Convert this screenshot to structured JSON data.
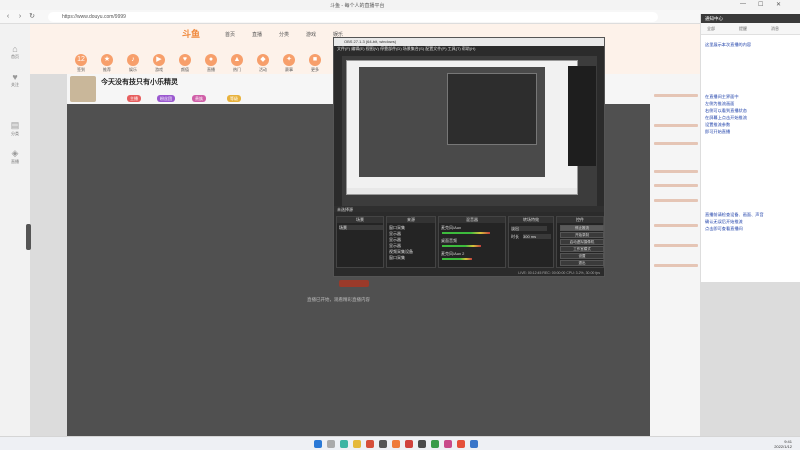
{
  "window": {
    "title": "斗鱼 - 每个人的直播平台"
  },
  "browser": {
    "url": "https://www.douyu.com/9999",
    "minimize": "—",
    "maximize": "☐",
    "close": "✕"
  },
  "sidebar": {
    "items": [
      {
        "icon": "⌂",
        "label": "首页"
      },
      {
        "icon": "♥",
        "label": "关注"
      },
      {
        "icon": "▤",
        "label": "分类"
      },
      {
        "icon": "◈",
        "label": "直播"
      }
    ]
  },
  "site": {
    "logo": "斗鱼",
    "nav": [
      "首页",
      "直播",
      "分类",
      "游戏",
      "娱乐"
    ],
    "categories": [
      {
        "icon": "12",
        "label": "签到"
      },
      {
        "icon": "★",
        "label": "推荐"
      },
      {
        "icon": "♪",
        "label": "娱乐"
      },
      {
        "icon": "▶",
        "label": "游戏"
      },
      {
        "icon": "♥",
        "label": "颜值"
      },
      {
        "icon": "●",
        "label": "直播"
      },
      {
        "icon": "▲",
        "label": "热门"
      },
      {
        "icon": "◆",
        "label": "活动"
      },
      {
        "icon": "✦",
        "label": "赛事"
      },
      {
        "icon": "■",
        "label": "更多"
      }
    ]
  },
  "room": {
    "title": "今天没有技只有小乐精灵",
    "tags": [
      "主播",
      "粉丝团",
      "贵族",
      "等级"
    ],
    "video_caption": "直播已开始，观看精彩直播内容"
  },
  "obs": {
    "title": "OBS 27.1.3 (64-bit, windows)",
    "menu": "文件(F)  编辑(E)  视图(V)  停靠部件(D)  场景集合(S)  配置文件(P)  工具(T)  帮助(H)",
    "status_strip": "未选择源",
    "docks": {
      "scenes": {
        "title": "场景",
        "items": [
          "场景"
        ]
      },
      "sources": {
        "title": "来源",
        "items": [
          "窗口采集",
          "显示器",
          "显示器",
          "显示器",
          "视频采集设备",
          "窗口采集"
        ]
      },
      "mixer": {
        "title": "混音器",
        "channels": [
          {
            "name": "麦克风/Aux",
            "level": 0.8
          },
          {
            "name": "桌面音频",
            "level": 0.65
          },
          {
            "name": "麦克风/Aux 2",
            "level": 0.5
          }
        ]
      },
      "transitions": {
        "title": "转场特效",
        "type": "淡出",
        "duration_label": "时长",
        "duration": "300 ms"
      },
      "controls": {
        "title": "控件",
        "buttons": [
          "停止推流",
          "开始录制",
          "启动虚拟摄像机",
          "工作室模式",
          "设置",
          "退出"
        ]
      }
    },
    "bottom": "LIVE: 00:12:45  REC: 00:00:00  CPU: 3.2%, 30.00 fps"
  },
  "notes": {
    "header": "通知中心",
    "tabs": [
      "全部",
      "提醒",
      "消息"
    ],
    "lines": [
      "这里展示本次直播的内容",
      "",
      "",
      "",
      "",
      "在直播间主界面中",
      "左侧为推流画面",
      "右侧可以看到直播状态",
      "在屏幕上点击开始推流",
      "设置推流参数",
      "即可开始直播",
      "",
      "",
      "",
      "",
      "",
      "",
      "",
      "",
      "直播前请检查设备、画面、声音",
      "确认无误后开始推流",
      "点击即可查看直播间"
    ]
  },
  "taskbar": {
    "time": "9:41",
    "date": "2022/1/12"
  },
  "colors": {
    "accent": "#f79f6b",
    "note_text": "#1a3da8",
    "obs_bg": "#2b2b2b",
    "video_bg": "#505050"
  }
}
